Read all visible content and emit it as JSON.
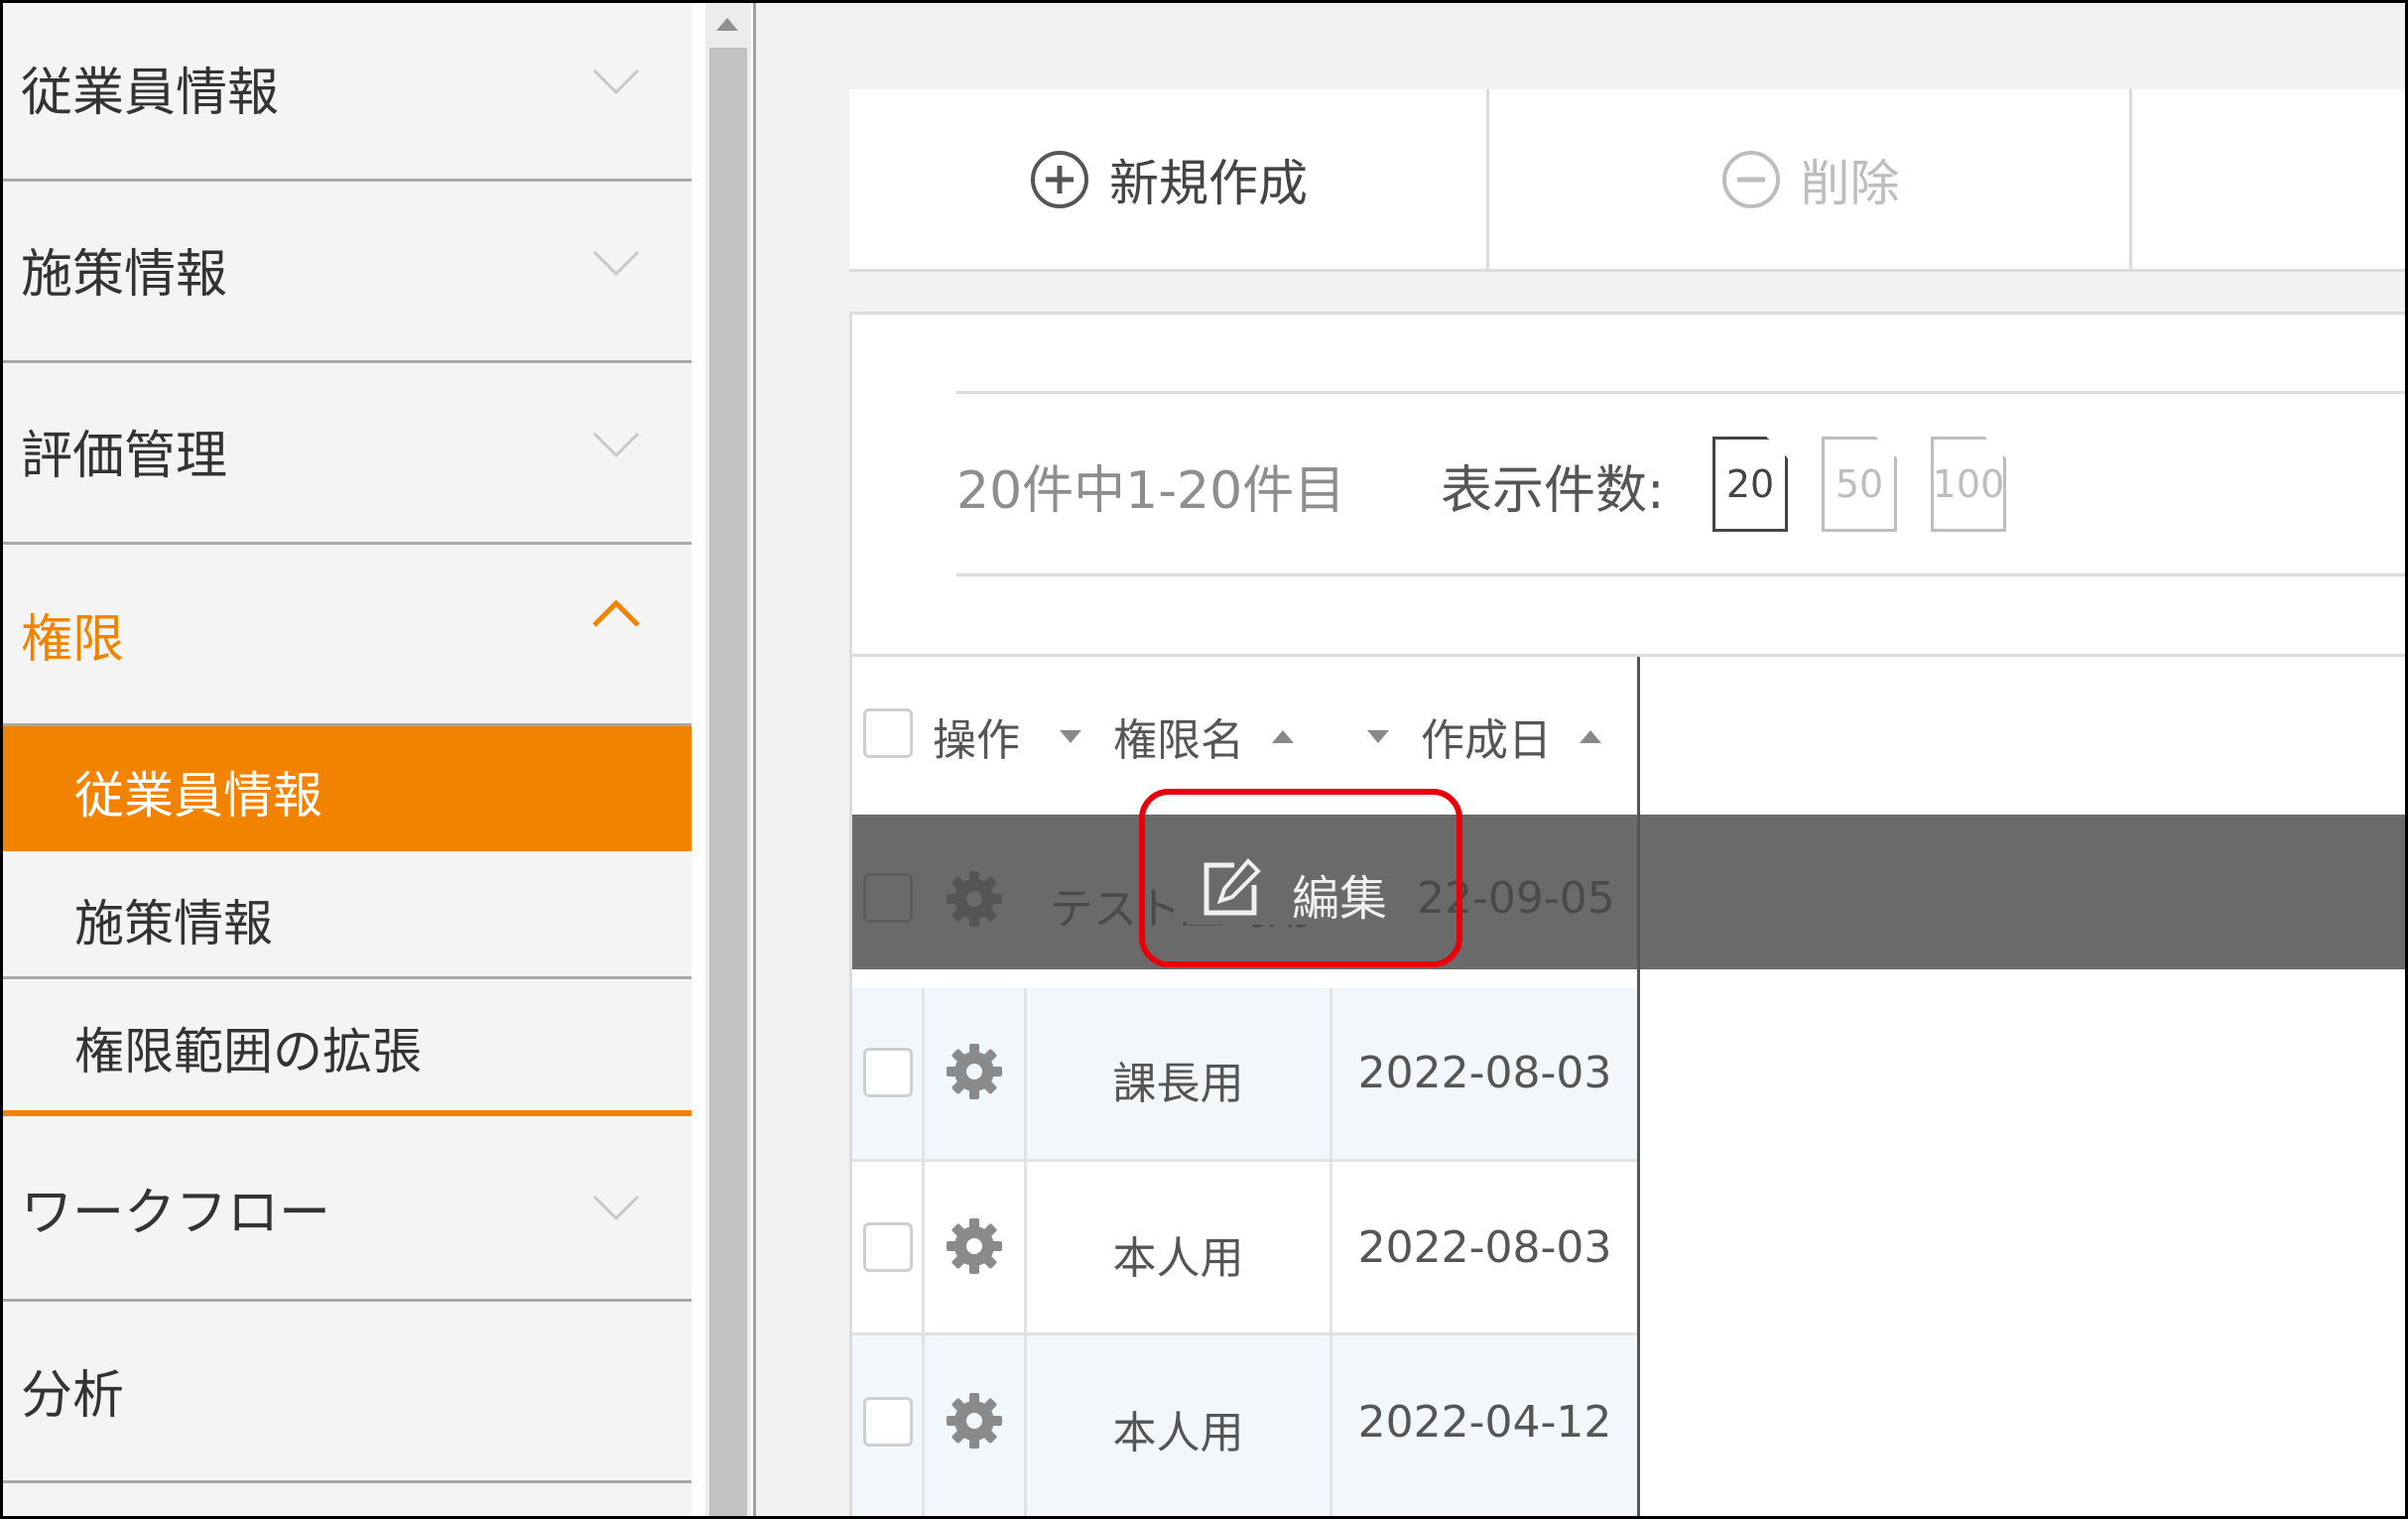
{
  "sidebar": {
    "items": [
      {
        "label": "従業員情報",
        "expanded": false
      },
      {
        "label": "施策情報",
        "expanded": false
      },
      {
        "label": "評価管理",
        "expanded": false
      },
      {
        "label": "権限",
        "expanded": true,
        "color": "#f28300"
      },
      {
        "label": "ワークフロー",
        "expanded": false
      },
      {
        "label": "分析",
        "expanded": false
      }
    ],
    "subitems": [
      {
        "label": "従業員情報",
        "active": true
      },
      {
        "label": "施策情報",
        "active": false
      },
      {
        "label": "権限範囲の拡張",
        "active": false
      }
    ]
  },
  "toolbar": {
    "new_label": "新規作成",
    "delete_label": "削除"
  },
  "pagination": {
    "count_text": "20件中1-20件目",
    "page_size_label": "表示件数:",
    "page_sizes": [
      "20",
      "50",
      "100"
    ],
    "selected_page_size": "20"
  },
  "table": {
    "headers": {
      "action": "操作",
      "name": "権限名",
      "created": "作成日"
    },
    "rows": [
      {
        "name": "テスト上司用",
        "created": "2022-09-05"
      },
      {
        "name": "課長用",
        "created": "2022-08-03"
      },
      {
        "name": "本人用",
        "created": "2022-08-03"
      },
      {
        "name": "本人用",
        "created": "2022-04-12"
      }
    ]
  },
  "context_menu": {
    "edit_label": "編集",
    "highlight_color": "#e8000b"
  },
  "icons": {
    "add": "plus-circle-icon",
    "remove": "minus-circle-icon",
    "gear": "gear-icon",
    "edit": "edit-icon",
    "chevron": "chevron-down-icon"
  },
  "colors": {
    "accent": "#f28300",
    "highlight_row": "#6a6a6a"
  }
}
